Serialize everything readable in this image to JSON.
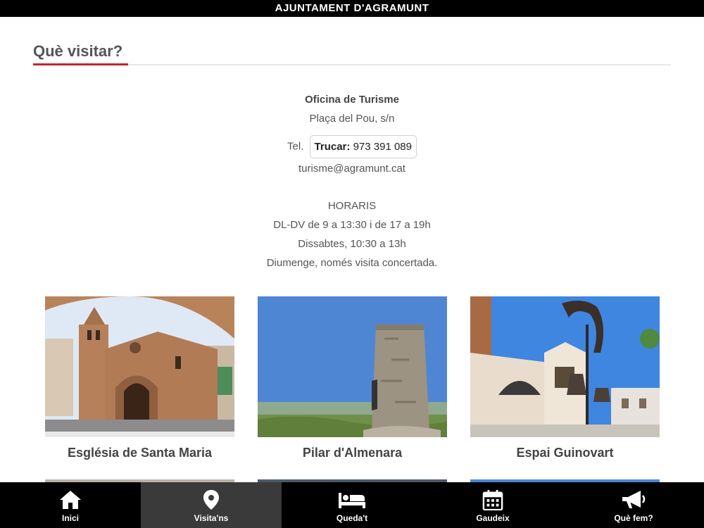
{
  "header": {
    "title": "AJUNTAMENT D'AGRAMUNT"
  },
  "section": {
    "title": "Què visitar?"
  },
  "office": {
    "name": "Oficina de Turisme",
    "address": "Plaça del Pou, s/n",
    "tel_label": "Tel.",
    "call_label": "Trucar:",
    "phone": "973 391 089",
    "email": "turisme@agramunt.cat"
  },
  "hours": {
    "title": "HORARIS",
    "lines": [
      "DL-DV de 9 a 13:30 i de 17 a 19h",
      "Dissabtes, 10:30 a 13h",
      "Diumenge, només visita concertada."
    ]
  },
  "places": [
    {
      "name": "Església de Santa Maria"
    },
    {
      "name": "Pilar d'Almenara"
    },
    {
      "name": "Espai Guinovart"
    }
  ],
  "nav": {
    "items": [
      {
        "label": "Inici",
        "icon": "home-icon"
      },
      {
        "label": "Visita'ns",
        "icon": "map-pin-icon"
      },
      {
        "label": "Queda't",
        "icon": "bed-icon"
      },
      {
        "label": "Gaudeix",
        "icon": "calendar-icon"
      },
      {
        "label": "Què fem?",
        "icon": "megaphone-icon"
      }
    ],
    "active": "Visita'ns"
  }
}
